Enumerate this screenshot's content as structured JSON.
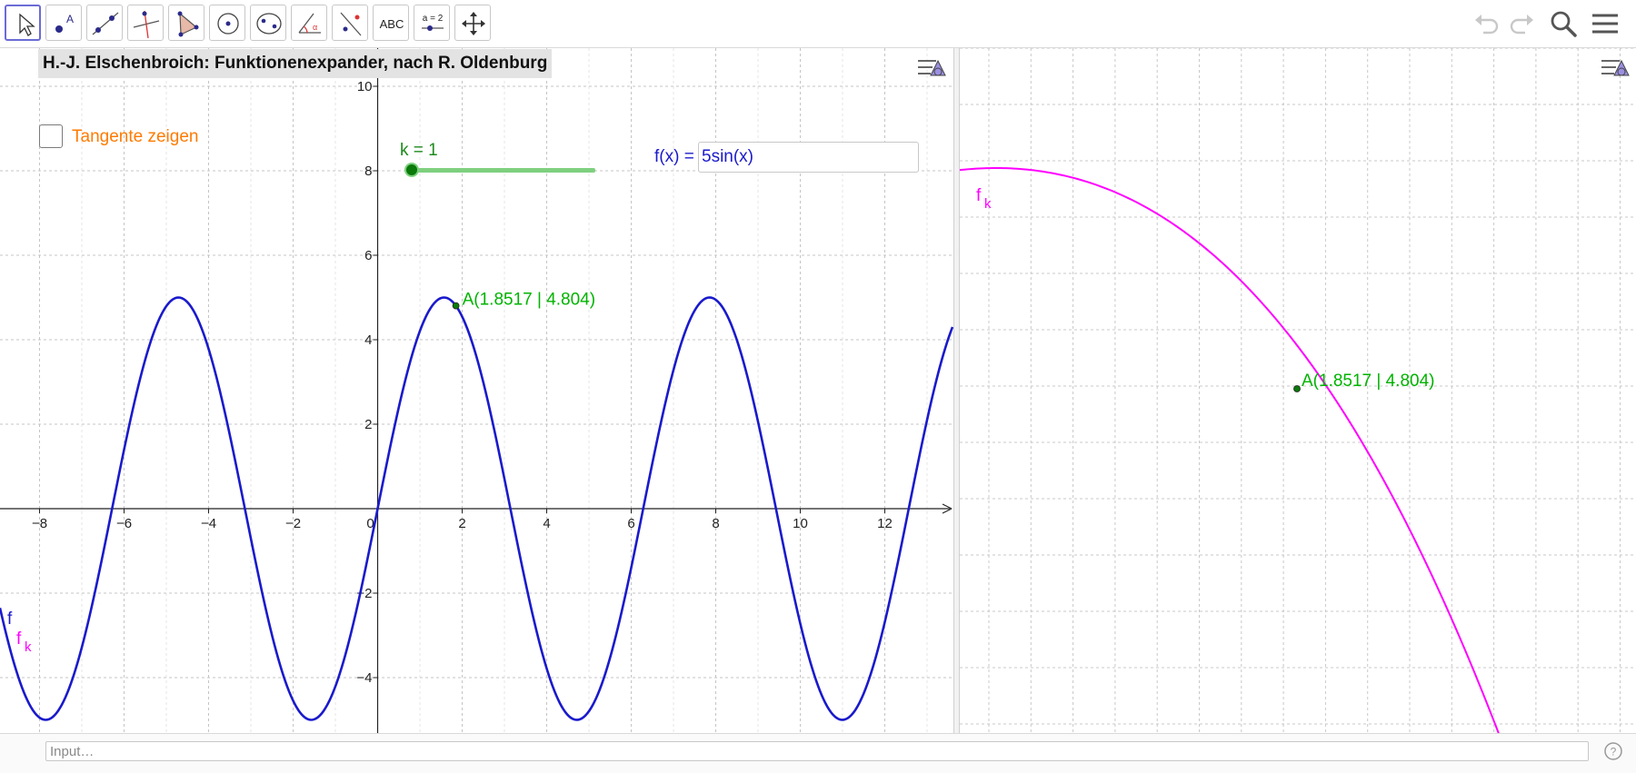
{
  "app": {
    "title": "H.-J. Elschenbroich: Funktionenexpander, nach R. Oldenburg"
  },
  "toolbar": {
    "tools": [
      {
        "name": "move-tool",
        "label": ""
      },
      {
        "name": "point-tool",
        "label": ""
      },
      {
        "name": "line-tool",
        "label": ""
      },
      {
        "name": "perpendicular-tool",
        "label": ""
      },
      {
        "name": "polygon-tool",
        "label": ""
      },
      {
        "name": "circle-tool",
        "label": ""
      },
      {
        "name": "ellipse-tool",
        "label": ""
      },
      {
        "name": "angle-tool",
        "label": ""
      },
      {
        "name": "reflect-tool",
        "label": ""
      },
      {
        "name": "text-tool",
        "label": "ABC"
      },
      {
        "name": "slider-tool",
        "label": "a = 2"
      },
      {
        "name": "move-view-tool",
        "label": ""
      }
    ],
    "right_icons": [
      "undo-icon",
      "redo-icon",
      "search-icon",
      "menu-icon"
    ]
  },
  "controls": {
    "checkbox_label": "Tangente zeigen",
    "checkbox_checked": false,
    "slider_label": "k = 1",
    "slider_value": 1,
    "slider_fraction": 0.0,
    "fx_label": "f(x) =",
    "fx_value": "5sin(x)"
  },
  "graph1": {
    "x_ticks": [
      "−8",
      "−6",
      "−4",
      "−2",
      "0",
      "2",
      "4",
      "6",
      "8",
      "10",
      "12"
    ],
    "y_ticks": [
      "10",
      "8",
      "6",
      "4",
      "2",
      "−2",
      "−4"
    ],
    "xlim": [
      -8.9,
      13.6
    ],
    "ylim": [
      -5.3,
      10.3
    ],
    "function": "5sin(x)",
    "curve_label_f": "f",
    "curve_label_fk": "f",
    "curve_label_fk_sub": "k",
    "point": {
      "x": 1.8517,
      "y": 4.804,
      "label": "A(1.8517 | 4.804)"
    }
  },
  "graph2": {
    "curve_label": "f",
    "curve_label_sub": "k",
    "point_label": "A(1.8517 | 4.804)"
  },
  "colors": {
    "function_blue": "#1a1acc",
    "fk_magenta": "#ff00ff",
    "point_green": "#00b300",
    "slider_green": "#1e8a1e",
    "checkbox_orange": "#ff7a00"
  },
  "input_bar": {
    "placeholder": "Input…"
  }
}
